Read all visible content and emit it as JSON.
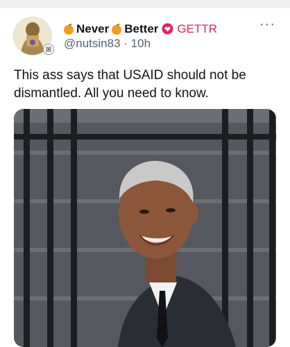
{
  "post": {
    "display_name_1": "Never",
    "display_name_2": "Better",
    "platform_tag": "GETTR",
    "handle": "@nutsin83",
    "separator": "·",
    "timestamp": "10h",
    "more_label": "···",
    "text": "This ass says that USAID should not be dismantled.  All you need to know.",
    "icons": {
      "name_emoji_1": "orange-emoji-icon",
      "name_emoji_2": "orange-emoji-icon",
      "platform_icon": "red-heart-badge-icon",
      "avatar_badge": "verified-badge-icon"
    }
  },
  "colors": {
    "handle_gray": "#536471",
    "gettr_red": "#e0245e",
    "text": "#0f1419"
  }
}
